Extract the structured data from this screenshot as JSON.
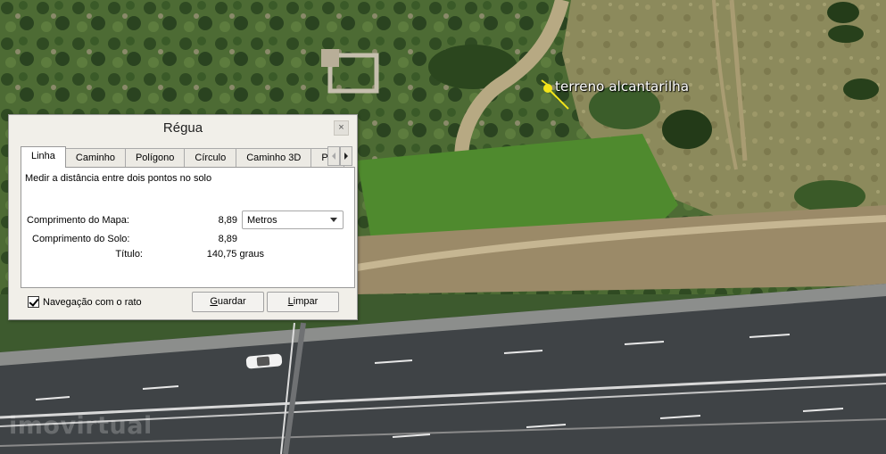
{
  "map": {
    "placemark_label": "terreno alcantarilha",
    "placemark_icon": "yellow-pushpin-icon",
    "watermark": "imovirtual"
  },
  "dialog": {
    "title": "Régua",
    "close_glyph": "×",
    "tabs": [
      {
        "label": "Linha",
        "active": true
      },
      {
        "label": "Caminho",
        "active": false
      },
      {
        "label": "Polígono",
        "active": false
      },
      {
        "label": "Círculo",
        "active": false
      },
      {
        "label": "Caminho 3D",
        "active": false
      },
      {
        "label": "Po",
        "active": false
      }
    ],
    "description": "Medir a distância entre dois pontos no solo",
    "fields": {
      "map_length_label": "Comprimento do Mapa:",
      "map_length_value": "8,89",
      "unit": "Metros",
      "ground_length_label": "Comprimento do Solo:",
      "ground_length_value": "8,89",
      "heading_label": "Título:",
      "heading_value": "140,75 graus"
    },
    "mouse_nav_label": "Navegação com o rato",
    "mouse_nav_checked": true,
    "save_button": {
      "prefix": "",
      "accel": "G",
      "rest": "uardar"
    },
    "clear_button": {
      "prefix": "",
      "accel": "L",
      "rest": "impar"
    }
  },
  "colors": {
    "dialog_bg": "#f1efe9",
    "placemark_yellow": "#f3e51a",
    "road": "#3f4346"
  }
}
